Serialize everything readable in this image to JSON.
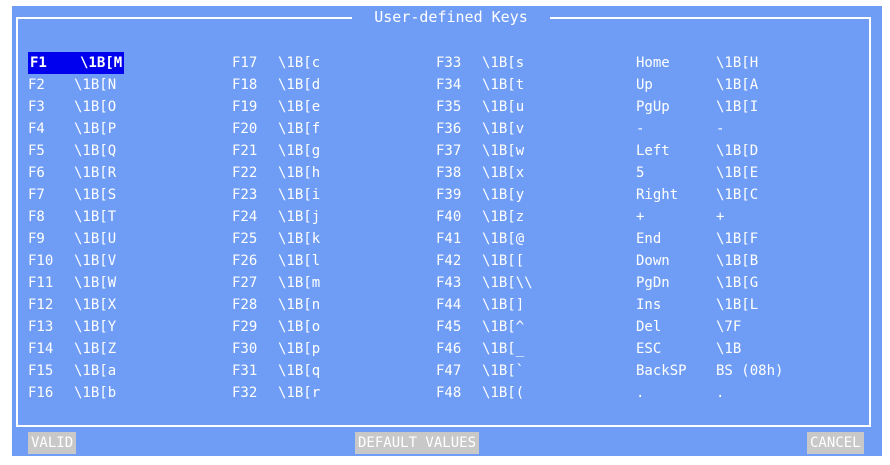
{
  "title": "User-defined Keys",
  "columns": [
    {
      "keys": [
        {
          "label": "F1",
          "value": "\\1B[M",
          "selected": true
        },
        {
          "label": "F2",
          "value": "\\1B[N"
        },
        {
          "label": "F3",
          "value": "\\1B[O"
        },
        {
          "label": "F4",
          "value": "\\1B[P"
        },
        {
          "label": "F5",
          "value": "\\1B[Q"
        },
        {
          "label": "F6",
          "value": "\\1B[R"
        },
        {
          "label": "F7",
          "value": "\\1B[S"
        },
        {
          "label": "F8",
          "value": "\\1B[T"
        },
        {
          "label": "F9",
          "value": "\\1B[U"
        },
        {
          "label": "F10",
          "value": "\\1B[V"
        },
        {
          "label": "F11",
          "value": "\\1B[W"
        },
        {
          "label": "F12",
          "value": "\\1B[X"
        },
        {
          "label": "F13",
          "value": "\\1B[Y"
        },
        {
          "label": "F14",
          "value": "\\1B[Z"
        },
        {
          "label": "F15",
          "value": "\\1B[a"
        },
        {
          "label": "F16",
          "value": "\\1B[b"
        }
      ]
    },
    {
      "keys": [
        {
          "label": "F17",
          "value": "\\1B[c"
        },
        {
          "label": "F18",
          "value": "\\1B[d"
        },
        {
          "label": "F19",
          "value": "\\1B[e"
        },
        {
          "label": "F20",
          "value": "\\1B[f"
        },
        {
          "label": "F21",
          "value": "\\1B[g"
        },
        {
          "label": "F22",
          "value": "\\1B[h"
        },
        {
          "label": "F23",
          "value": "\\1B[i"
        },
        {
          "label": "F24",
          "value": "\\1B[j"
        },
        {
          "label": "F25",
          "value": "\\1B[k"
        },
        {
          "label": "F26",
          "value": "\\1B[l"
        },
        {
          "label": "F27",
          "value": "\\1B[m"
        },
        {
          "label": "F28",
          "value": "\\1B[n"
        },
        {
          "label": "F29",
          "value": "\\1B[o"
        },
        {
          "label": "F30",
          "value": "\\1B[p"
        },
        {
          "label": "F31",
          "value": "\\1B[q"
        },
        {
          "label": "F32",
          "value": "\\1B[r"
        }
      ]
    },
    {
      "keys": [
        {
          "label": "F33",
          "value": "\\1B[s"
        },
        {
          "label": "F34",
          "value": "\\1B[t"
        },
        {
          "label": "F35",
          "value": "\\1B[u"
        },
        {
          "label": "F36",
          "value": "\\1B[v"
        },
        {
          "label": "F37",
          "value": "\\1B[w"
        },
        {
          "label": "F38",
          "value": "\\1B[x"
        },
        {
          "label": "F39",
          "value": "\\1B[y"
        },
        {
          "label": "F40",
          "value": "\\1B[z"
        },
        {
          "label": "F41",
          "value": "\\1B[@"
        },
        {
          "label": "F42",
          "value": "\\1B[["
        },
        {
          "label": "F43",
          "value": "\\1B[\\\\"
        },
        {
          "label": "F44",
          "value": "\\1B[]"
        },
        {
          "label": "F45",
          "value": "\\1B[^"
        },
        {
          "label": "F46",
          "value": "\\1B[_"
        },
        {
          "label": "F47",
          "value": "\\1B[`"
        },
        {
          "label": "F48",
          "value": "\\1B[("
        }
      ]
    },
    {
      "keys": [
        {
          "label": "Home",
          "value": "\\1B[H"
        },
        {
          "label": "Up",
          "value": "\\1B[A"
        },
        {
          "label": "PgUp",
          "value": "\\1B[I"
        },
        {
          "label": "-",
          "value": "-"
        },
        {
          "label": "Left",
          "value": "\\1B[D"
        },
        {
          "label": "5",
          "value": "\\1B[E"
        },
        {
          "label": "Right",
          "value": "\\1B[C"
        },
        {
          "label": "+",
          "value": "+"
        },
        {
          "label": "End",
          "value": "\\1B[F"
        },
        {
          "label": "Down",
          "value": "\\1B[B"
        },
        {
          "label": "PgDn",
          "value": "\\1B[G"
        },
        {
          "label": "Ins",
          "value": "\\1B[L"
        },
        {
          "label": "Del",
          "value": "\\7F"
        },
        {
          "label": "ESC",
          "value": "\\1B"
        },
        {
          "label": "BackSP",
          "value": "BS (08h)"
        },
        {
          "label": ".",
          "value": "."
        }
      ]
    }
  ],
  "buttons": {
    "valid": "VALID",
    "default_values": "DEFAULT VALUES",
    "cancel": "CANCEL"
  },
  "colors": {
    "panel_bg": "#6f9df5",
    "text": "#ffffff",
    "selection_bg": "#0000ee",
    "button_bg": "#c8c8c8"
  }
}
